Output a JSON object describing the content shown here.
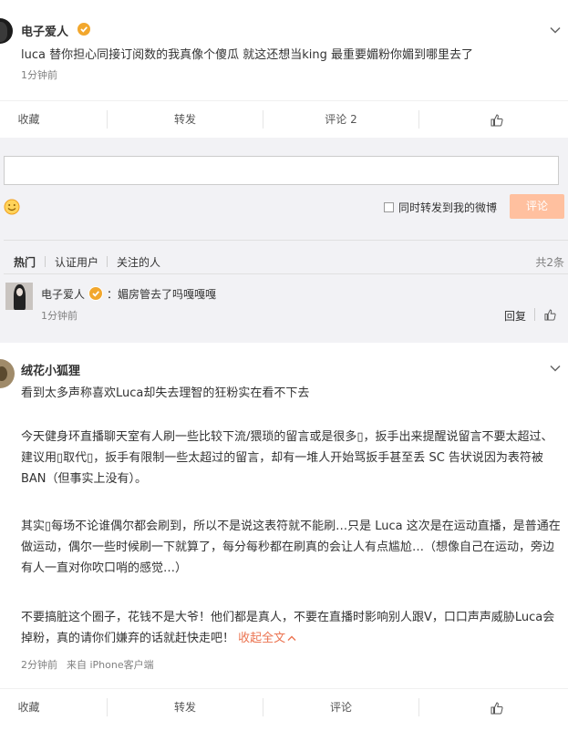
{
  "post1": {
    "author": "电子爱人",
    "text": "luca 替你担心同接订阅数的我真像个傻瓜 就这还想当king 最重要媚粉你媚到哪里去了",
    "time": "1分钟前",
    "actions": {
      "favorite": "收藏",
      "repost": "转发",
      "comment": "评论 2"
    }
  },
  "composer": {
    "input_placeholder": "",
    "repost_checkbox_label": "同时转发到我的微博",
    "submit_label": "评论",
    "accent_color": "#ffc09f"
  },
  "comment_tabs": {
    "hot": "热门",
    "verified": "认证用户",
    "following": "关注的人",
    "count": "共2条"
  },
  "comment1": {
    "author": "电子爱人",
    "text": "：媚房管去了吗嘎嘎嘎",
    "time": "1分钟前",
    "reply_label": "回复"
  },
  "post2": {
    "author": "绒花小狐狸",
    "headline": "看到太多声称喜欢Luca却失去理智的狂粉实在看不下去",
    "para1": "今天健身环直播聊天室有人刷一些比较下流/猥琐的留言或是很多▯，扳手出来提醒说留言不要太超过、建议用▯取代▯，扳手有限制一些太超过的留言，却有一堆人开始骂扳手甚至丢 SC 告状说因为表符被 BAN（但事实上没有）。",
    "para2": "其实▯每场不论谁偶尔都会刷到，所以不是说这表符就不能刷…只是 Luca 这次是在运动直播，是普通在做运动，偶尔一些时候刷一下就算了，每分每秒都在刷真的会让人有点尴尬…（想像自己在运动，旁边有人一直对你吹口哨的感觉…）",
    "para3": "不要搞脏这个圈子，花钱不是大爷！他们都是真人，不要在直播时影响别人跟V，口口声声威胁Luca会掉粉，真的请你们嫌弃的话就赶快走吧！",
    "collapse_label": "收起全文",
    "time": "2分钟前",
    "source": "来自 iPhone客户端",
    "actions": {
      "favorite": "收藏",
      "repost": "转发",
      "comment": "评论"
    }
  },
  "colors": {
    "link": "#eb7350",
    "verified": "#f2a72d"
  }
}
